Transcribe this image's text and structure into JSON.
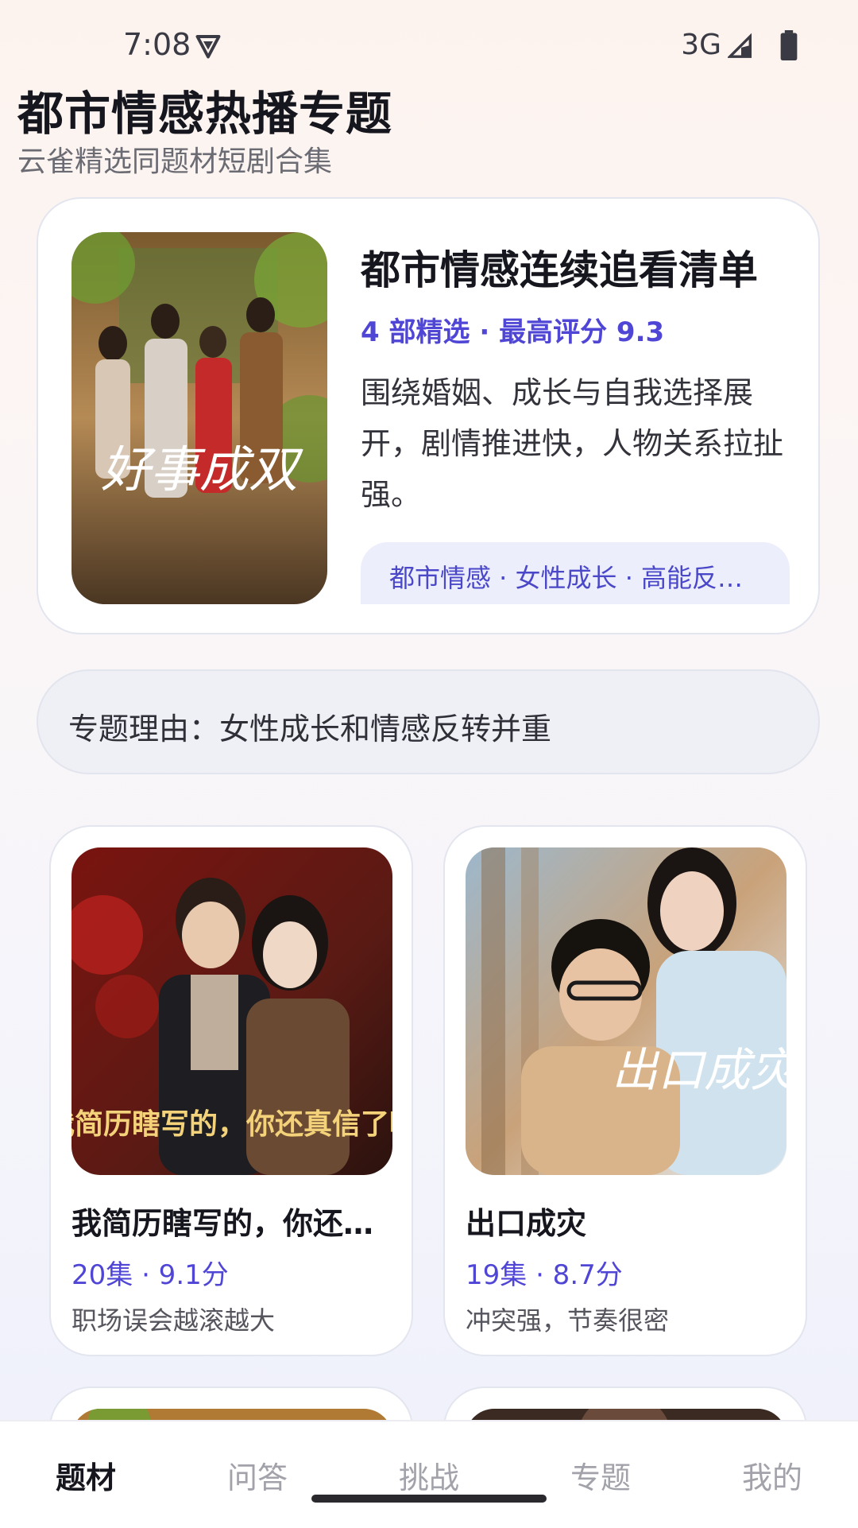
{
  "status_bar": {
    "time": "7:08",
    "network": "3G"
  },
  "header": {
    "title": "都市情感热播专题",
    "subtitle": "云雀精选同题材短剧合集"
  },
  "feature": {
    "title": "都市情感连续追看清单",
    "meta": "4 部精选 · 最高评分 9.3",
    "description": "围绕婚姻、成长与自我选择展开，剧情推进快，人物关系拉扯强。",
    "tags": "都市情感 · 女性成长 · 高能反转…",
    "poster_text": "好事成双"
  },
  "reason": "专题理由：女性成长和情感反转并重",
  "cards": [
    {
      "title": "我简历瞎写的，你还真信了啊",
      "meta": "20集 · 9.1分",
      "note": "职场误会越滚越大",
      "poster_text": "我简历瞎写的，你还真信了啊"
    },
    {
      "title": "出口成灾",
      "meta": "19集 · 8.7分",
      "note": "冲突强，节奏很密",
      "poster_text": "出口成灾"
    }
  ],
  "nav": {
    "items": [
      "题材",
      "问答",
      "挑战",
      "专题",
      "我的"
    ],
    "active": "题材"
  }
}
